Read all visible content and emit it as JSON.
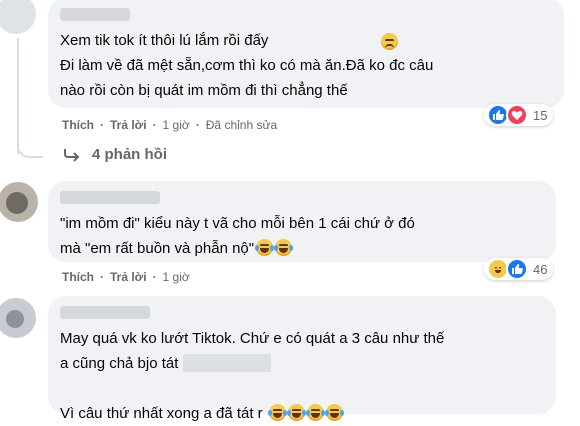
{
  "comments": [
    {
      "text": "Xem tik tok ít thôi lú lắm rồi đấy\nĐi làm về đã mệt sẵn,cơm thì ko có mà ăn.Đã ko đc câu\nnào rồi còn bị quát im mồm đi thì chẳng thế",
      "emoji": "pensive-face",
      "actions": {
        "like": "Thích",
        "reply": "Trả lời",
        "time": "1 giờ",
        "edited": "Đã chỉnh sửa"
      },
      "reactions": {
        "types": [
          "like",
          "love"
        ],
        "count": "15"
      },
      "replies": "4 phản hồi"
    },
    {
      "text": "\"im mồm đi\" kiểu này t vã cho mỗi bên 1 cái chứ ở đó\nmà \"em rất buồn và phẫn nộ\"",
      "emoji": "tears-of-joy",
      "actions": {
        "like": "Thích",
        "reply": "Trả lời",
        "time": "1 giờ"
      },
      "reactions": {
        "types": [
          "haha",
          "like"
        ],
        "count": "46"
      }
    },
    {
      "text_line1": "May quá vk ko lướt Tiktok. Chứ e có quát a 3 câu như thế",
      "text_line2": "a cũng chả bjo tát",
      "text_line3": "Vì câu thứ nhất xong a đã tát r",
      "emoji": "tears-of-joy"
    }
  ],
  "separator": "·",
  "colors": {
    "bubble": "#f0f2f5",
    "meta": "#65676b",
    "like": "#1877f2",
    "love": "#f33e58",
    "haha": "#f7c948"
  }
}
